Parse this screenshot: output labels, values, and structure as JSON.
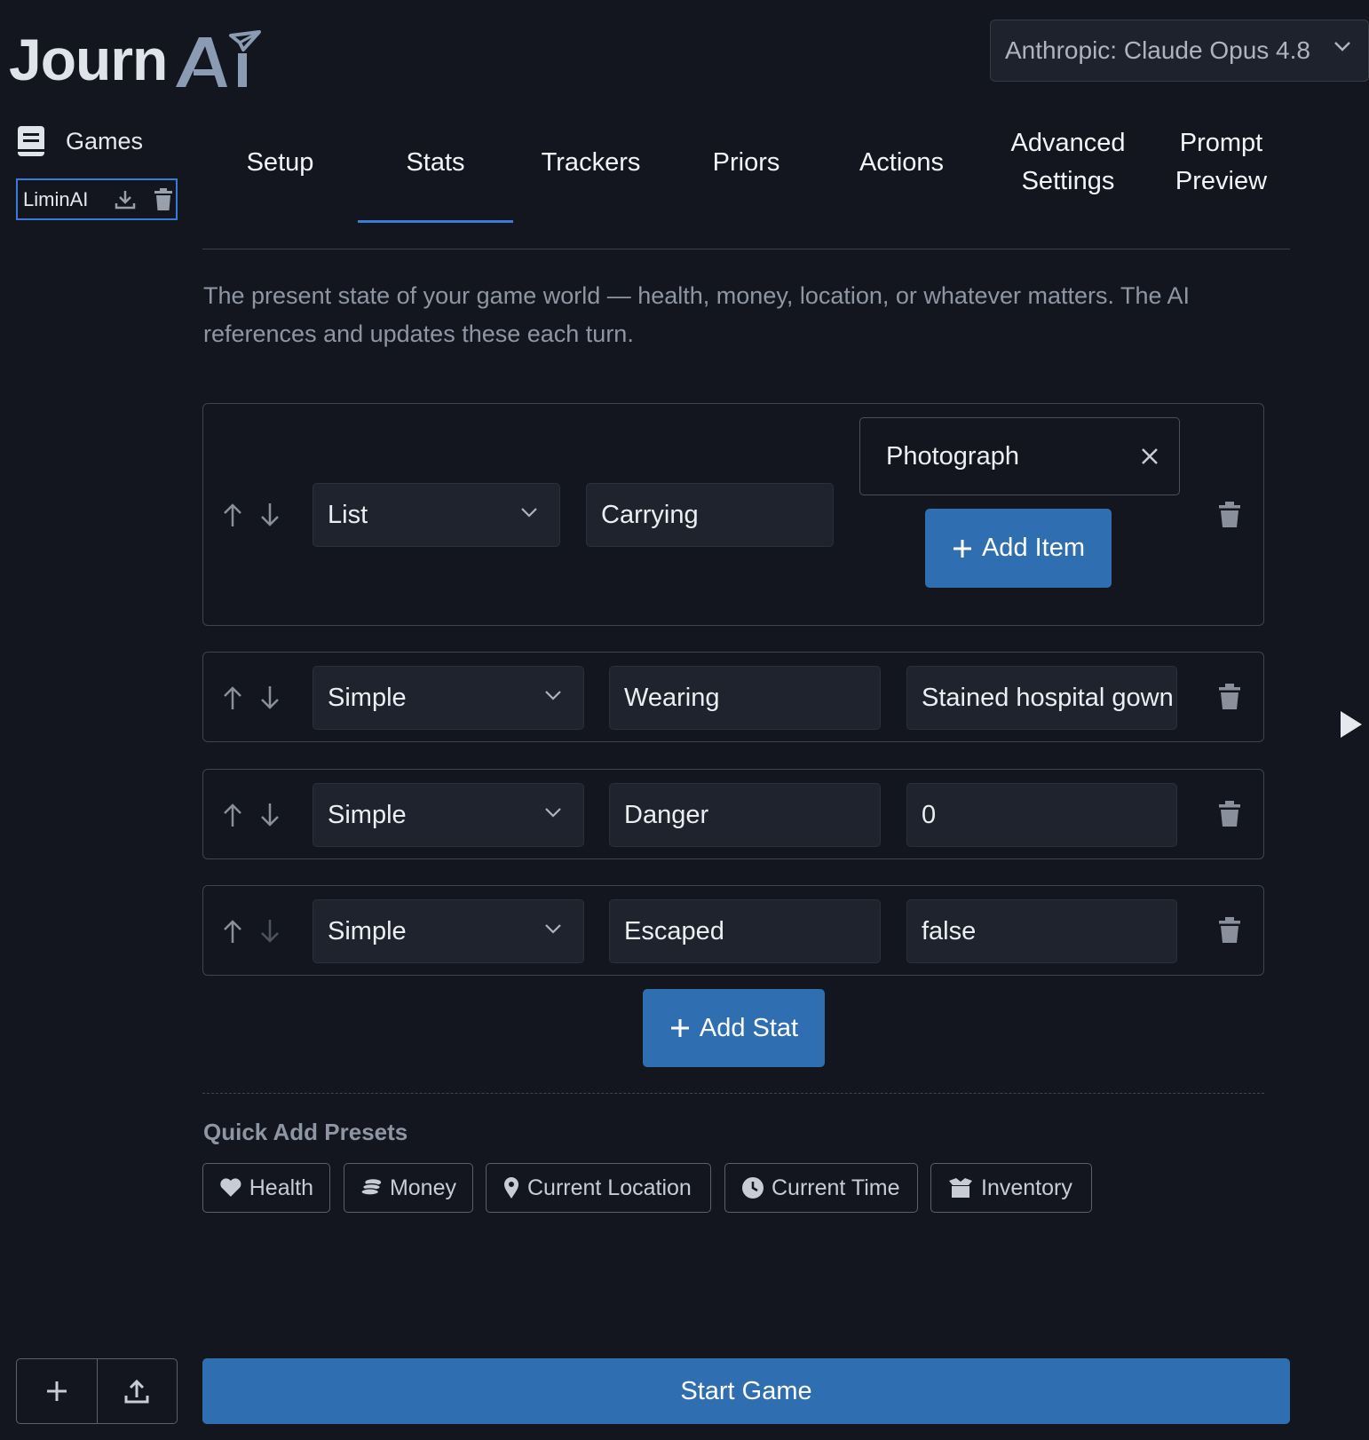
{
  "app": {
    "logo_text": "Journ",
    "logo_suffix": "Ai"
  },
  "header": {
    "model_select_value": "Anthropic: Claude Opus 4.8"
  },
  "sidebar": {
    "games_label": "Games",
    "games": [
      {
        "name": "LiminAI"
      }
    ]
  },
  "tabs": [
    {
      "label": "Setup",
      "active": false
    },
    {
      "label": "Stats",
      "active": true
    },
    {
      "label": "Trackers",
      "active": false
    },
    {
      "label": "Priors",
      "active": false
    },
    {
      "label": "Actions",
      "active": false
    },
    {
      "label": "Advanced Settings",
      "active": false
    },
    {
      "label": "Prompt Preview",
      "active": false
    }
  ],
  "description": "The present state of your game world — health, money, location, or whatever matters. The AI references and updates these each turn.",
  "stats": [
    {
      "type": "List",
      "name": "Carrying",
      "items": [
        "Photograph"
      ],
      "add_item_label": "Add Item"
    },
    {
      "type": "Simple",
      "name": "Wearing",
      "value": "Stained hospital gown"
    },
    {
      "type": "Simple",
      "name": "Danger",
      "value": "0"
    },
    {
      "type": "Simple",
      "name": "Escaped",
      "value": "false"
    }
  ],
  "add_stat_label": "Add Stat",
  "presets": {
    "title": "Quick Add Presets",
    "items": [
      {
        "label": "Health",
        "icon": "heart-icon"
      },
      {
        "label": "Money",
        "icon": "coins-icon"
      },
      {
        "label": "Current Location",
        "icon": "map-pin-icon"
      },
      {
        "label": "Current Time",
        "icon": "clock-icon"
      },
      {
        "label": "Inventory",
        "icon": "box-icon"
      }
    ]
  },
  "start_game_label": "Start Game",
  "colors": {
    "background": "#13161f",
    "accent": "#2f6fb1",
    "tab_underline": "#3a7bd5"
  }
}
